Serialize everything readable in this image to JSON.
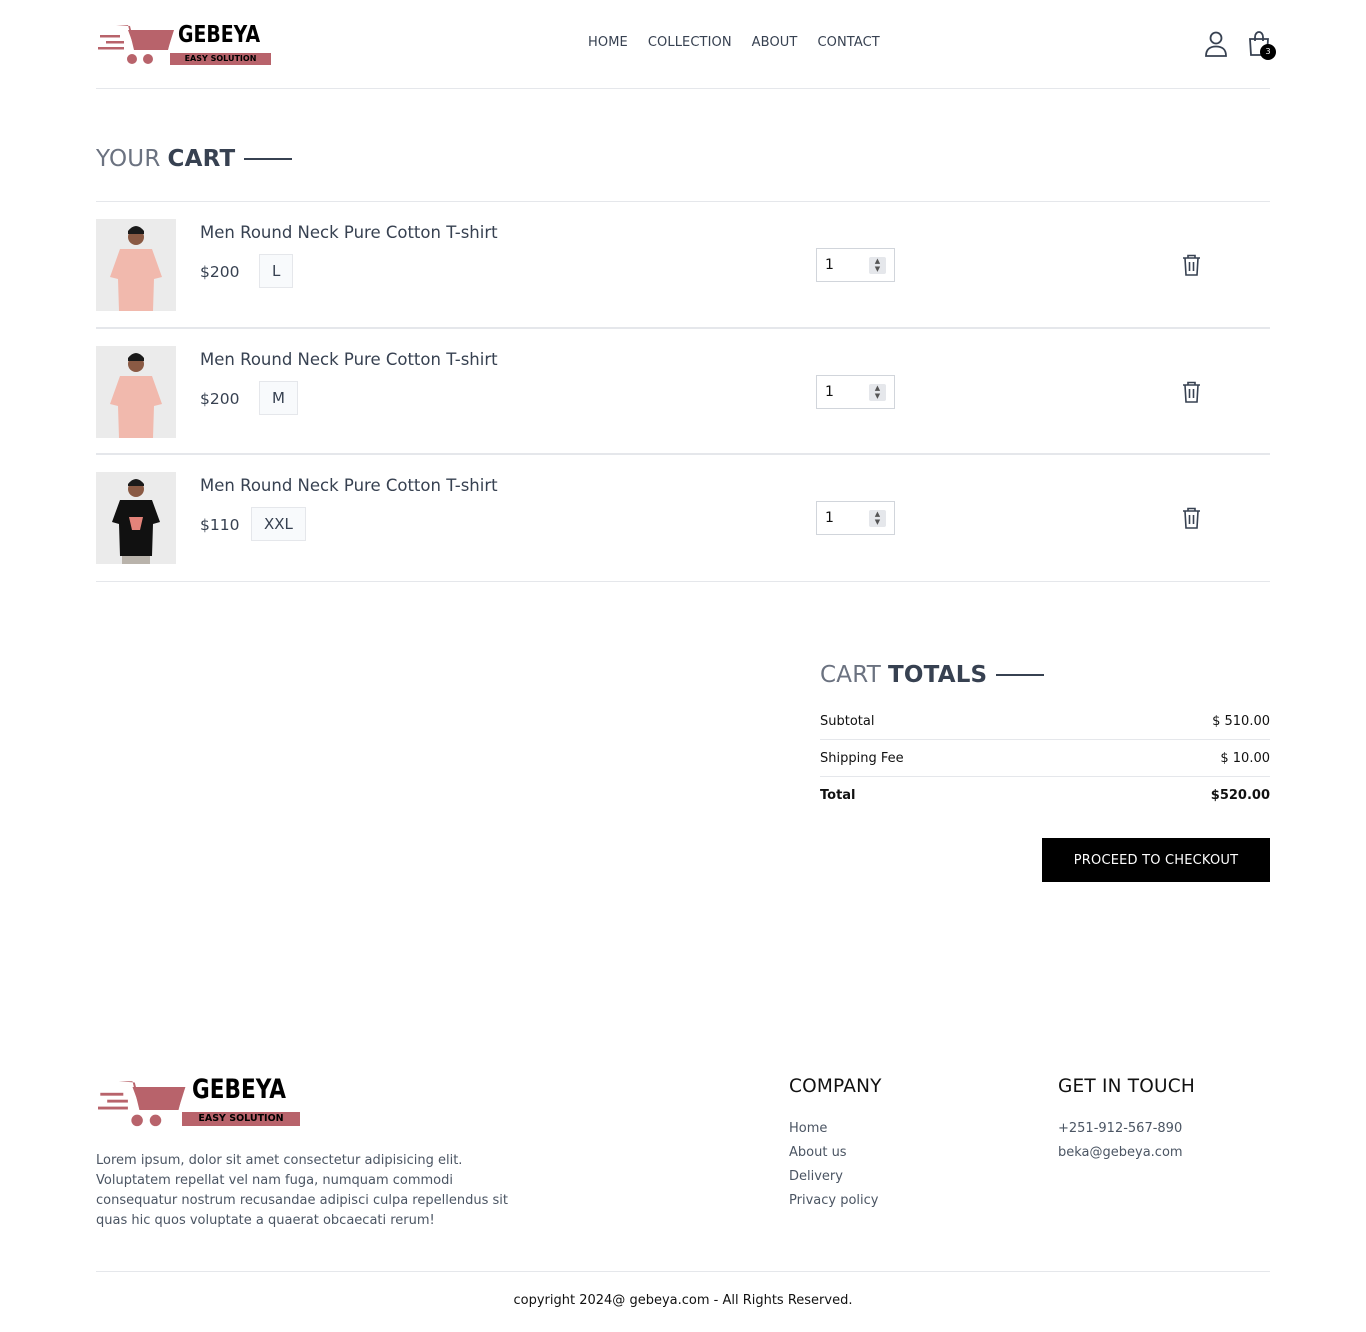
{
  "brand": {
    "name": "GEBEYA",
    "tagline": "EASY SOLUTION"
  },
  "nav": [
    "HOME",
    "COLLECTION",
    "ABOUT",
    "CONTACT"
  ],
  "header": {
    "cart_count": "3"
  },
  "cart": {
    "title_light": "YOUR",
    "title_strong": "CART",
    "items": [
      {
        "name": "Men Round Neck Pure Cotton T-shirt",
        "price": "$200",
        "size": "L",
        "qty": "1",
        "shirt_color": "#f1b9ad"
      },
      {
        "name": "Men Round Neck Pure Cotton T-shirt",
        "price": "$200",
        "size": "M",
        "qty": "1",
        "shirt_color": "#f1b9ad"
      },
      {
        "name": "Men Round Neck Pure Cotton T-shirt",
        "price": "$110",
        "size": "XXL",
        "qty": "1",
        "shirt_color": "#111111"
      }
    ]
  },
  "totals": {
    "title_light": "CART",
    "title_strong": "TOTALS",
    "subtotal_label": "Subtotal",
    "subtotal": "$ 510.00",
    "shipping_label": "Shipping Fee",
    "shipping": "$ 10.00",
    "total_label": "Total",
    "total": "$520.00",
    "checkout_label": "PROCEED TO CHECKOUT"
  },
  "footer": {
    "about": "Lorem ipsum, dolor sit amet consectetur adipisicing elit. Voluptatem repellat vel nam fuga, numquam commodi consequatur nostrum recusandae adipisci culpa repellendus sit quas hic quos voluptate a quaerat obcaecati rerum!",
    "company_title": "COMPANY",
    "company_links": [
      "Home",
      "About us",
      "Delivery",
      "Privacy policy"
    ],
    "contact_title": "GET IN TOUCH",
    "phone": "+251-912-567-890",
    "email": "beka@gebeya.com",
    "copyright": "copyright 2024@ gebeya.com - All Rights Reserved."
  },
  "colors": {
    "accent": "#b8636b",
    "button": "#000000"
  }
}
